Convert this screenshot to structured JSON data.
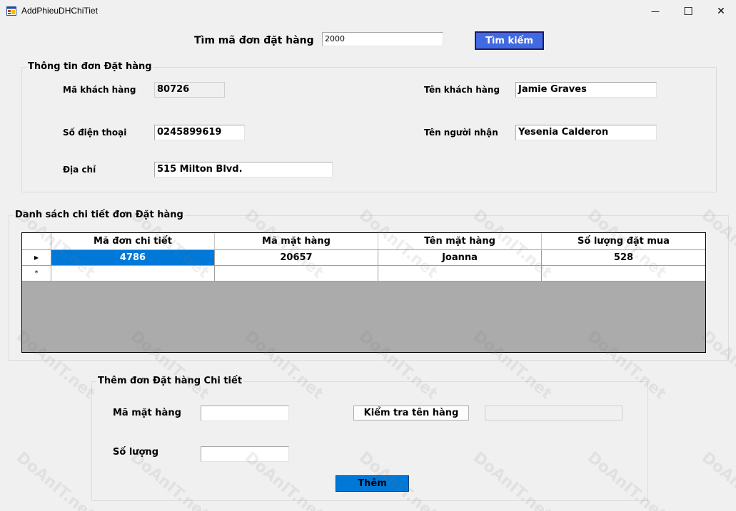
{
  "window": {
    "title": "AddPhieuDHChiTiet",
    "minimize_glyph": "—",
    "maximize_glyph": "☐",
    "close_glyph": "✕"
  },
  "search": {
    "label": "Tìm mã đơn đặt hàng",
    "value": "2000",
    "button_label": "Tìm kiếm"
  },
  "order_info": {
    "title": "Thông tin đơn Đặt hàng",
    "customer_id_label": "Mã khách hàng",
    "customer_id_value": "80726",
    "customer_name_label": "Tên khách hàng",
    "customer_name_value": "Jamie Graves",
    "phone_label": "Số điện thoại",
    "phone_value": "0245899619",
    "recipient_label": "Tên người nhận",
    "recipient_value": "Yesenia Calderon",
    "address_label": "Địa chỉ",
    "address_value": "515 Milton Blvd."
  },
  "detail_list": {
    "title": "Danh sách chi tiết đơn Đặt hàng",
    "columns": [
      "Mã đơn chi tiết",
      "Mã mặt hàng",
      "Tên mặt hàng",
      "Số lượng đặt mua"
    ],
    "rows": [
      {
        "indicator": "▶",
        "cells": [
          "4786",
          "20657",
          "Joanna",
          "528"
        ]
      },
      {
        "indicator": "*",
        "cells": [
          "",
          "",
          "",
          ""
        ]
      }
    ]
  },
  "add_detail": {
    "title": "Thêm đơn Đặt hàng Chi tiết",
    "item_code_label": "Mã mặt hàng",
    "item_code_value": "",
    "check_button_label": "Kiểm tra tên hàng",
    "item_name_value": "",
    "quantity_label": "Số lượng",
    "quantity_value": "",
    "add_button_label": "Thêm"
  },
  "watermark": {
    "text": "DoAnIT.net"
  },
  "colors": {
    "background": "#f0f0f0",
    "search_button": "#4169e1",
    "add_button": "#0078d7",
    "selected_cell": "#0078d7",
    "grid_empty": "#ababab"
  }
}
